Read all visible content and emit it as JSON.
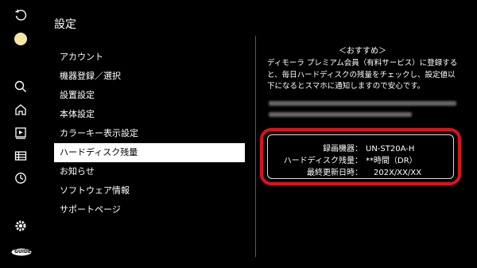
{
  "page": {
    "title": "設定"
  },
  "rail_icons": [
    "refresh-icon",
    "profile-icon",
    "search-icon",
    "home-icon",
    "video-icon",
    "list-icon",
    "clock-icon",
    "settings-icon",
    "gguide-logo"
  ],
  "menu": {
    "items": [
      {
        "label": "アカウント"
      },
      {
        "label": "機器登録／選択"
      },
      {
        "label": "設置設定"
      },
      {
        "label": "本体設定"
      },
      {
        "label": "カラーキー表示設定"
      },
      {
        "label": "ハードディスク残量"
      },
      {
        "label": "お知らせ"
      },
      {
        "label": "ソフトウェア情報"
      },
      {
        "label": "サポートページ"
      }
    ],
    "selected_index": 5
  },
  "recommend": {
    "heading": "＜おすすめ＞",
    "line1": "ディモーラ プレミアム会員（有料サービス）に登録すると、毎日ハードディスクの残量をチェックし、設定値以",
    "line2": "下になるとスマホに通知しますので安心です。"
  },
  "device_info": {
    "recorder_label": "録画機器：",
    "recorder_value": "UN-ST20A-H",
    "remaining_label": "ハードディスク残量：",
    "remaining_value": "**時間（DR）",
    "updated_label": "最終更新日時：",
    "updated_value": "202X/XX/XX"
  },
  "logo": {
    "text": "GUIDE"
  },
  "colors": {
    "background": "#000000",
    "highlight": "#e0111c",
    "selected_bg": "#ffffff",
    "divider": "#5a5a5a"
  }
}
